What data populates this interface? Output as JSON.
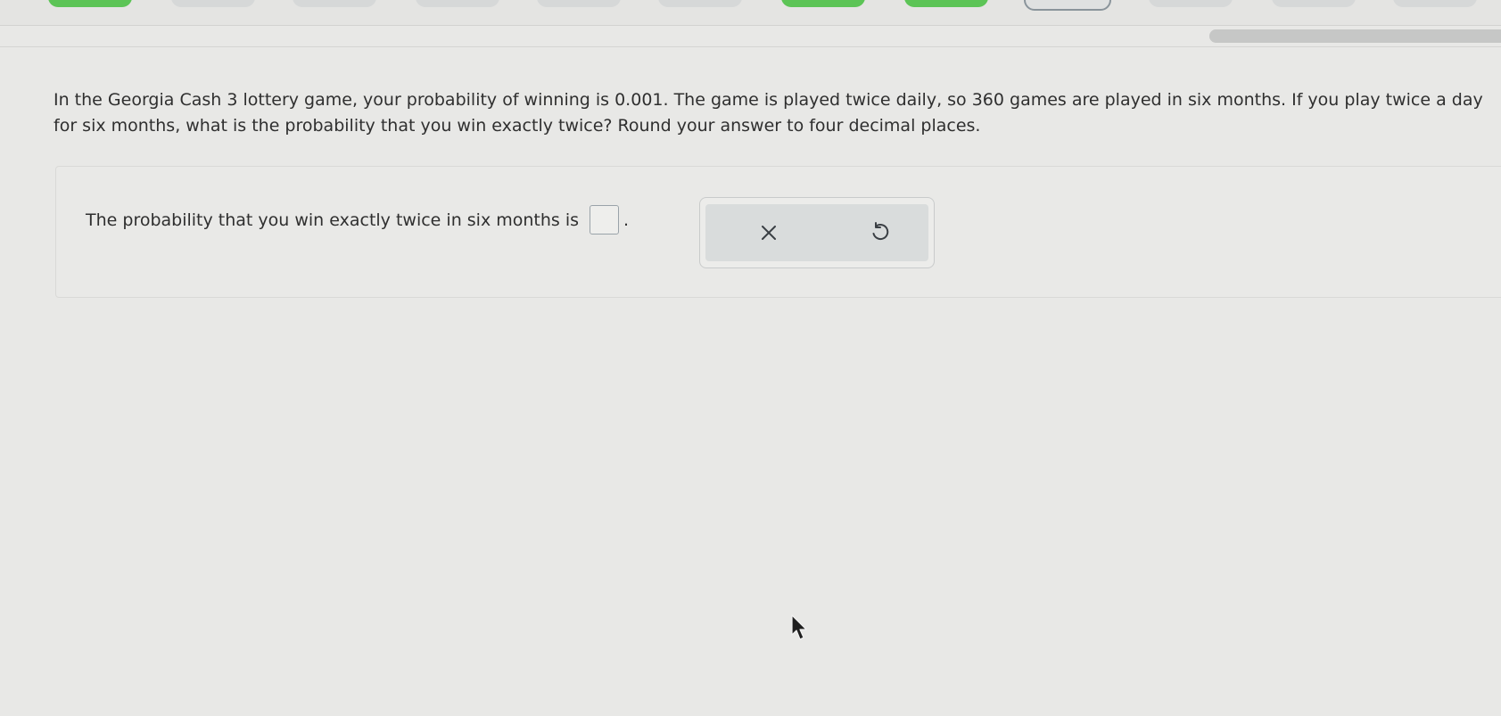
{
  "question": {
    "text": "In the Georgia Cash 3 lottery game, your probability of winning is 0.001. The game is played twice daily, so 360 games are played in six months. If you play twice a day for six months, what is the probability that you win exactly twice? Round your answer to four decimal places."
  },
  "answer": {
    "prompt": "The probability that you win exactly twice in six months is",
    "value": "",
    "suffix": "."
  },
  "toolbar": {
    "clear_icon": "x-icon",
    "undo_icon": "undo-icon"
  },
  "progress": {
    "fraction": 1.0
  },
  "colors": {
    "completed": "#5cc456",
    "background": "#e8e8e6"
  }
}
